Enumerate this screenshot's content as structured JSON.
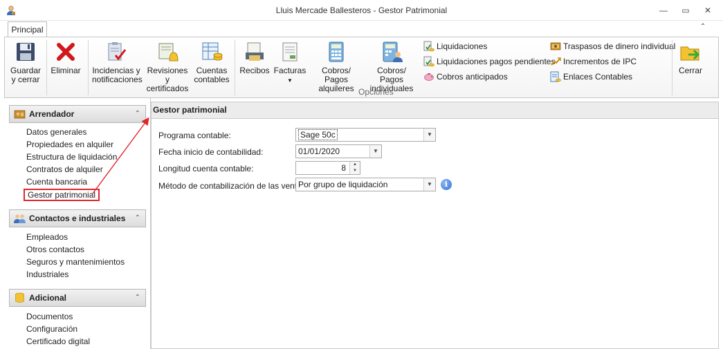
{
  "window": {
    "title": "Lluis Mercade Ballesteros - Gestor Patrimonial",
    "minimize": "—",
    "maximize": "▭",
    "close": "✕"
  },
  "ribbon": {
    "tabs": [
      "Principal"
    ],
    "collapse_glyph": "⌃",
    "buttons": {
      "guardar": "Guardar y cerrar",
      "eliminar": "Eliminar",
      "incidencias": "Incidencias y notificaciones",
      "revisiones": "Revisiones y certificados",
      "cuentas": "Cuentas contables",
      "recibos": "Recibos",
      "facturas": "Facturas",
      "cobros_alquileres": "Cobros/ Pagos alquileres",
      "cobros_individuales": "Cobros/ Pagos individuales",
      "cerrar": "Cerrar"
    },
    "group_label": "Opciones",
    "small_items": {
      "liquidaciones": "Liquidaciones",
      "liquidaciones_pendientes": "Liquidaciones pagos pendientes",
      "cobros_anticipados": "Cobros anticipados",
      "traspasos": "Traspasos de dinero individual",
      "incrementos_ipc": "Incrementos de IPC",
      "enlaces_contables": "Enlaces Contables"
    },
    "icons": {
      "guardar": "floppy-disk-icon",
      "eliminar": "red-x-icon",
      "incidencias": "clipboard-check-icon",
      "revisiones": "certificate-bell-icon",
      "cuentas": "ledger-coins-icon",
      "recibos": "receipt-printer-icon",
      "facturas": "invoice-icon",
      "cobros_alquileres": "calculator-icon",
      "cobros_individuales": "calculator-user-icon",
      "cerrar": "folder-exit-icon"
    }
  },
  "sidebar": {
    "sections": [
      {
        "title": "Arrendador",
        "items": [
          "Datos generales",
          "Propiedades en alquiler",
          "Estructura de liquidación",
          "Contratos de alquiler",
          "Cuenta bancaria",
          "Gestor patrimonial"
        ]
      },
      {
        "title": "Contactos e industriales",
        "items": [
          "Empleados",
          "Otros contactos",
          "Seguros y mantenimientos",
          "Industriales"
        ]
      },
      {
        "title": "Adicional",
        "items": [
          "Documentos",
          "Configuración",
          "Certificado digital"
        ]
      }
    ],
    "active_item": "Gestor patrimonial",
    "chevron": "⌃"
  },
  "content": {
    "header": "Gestor patrimonial",
    "fields": {
      "programa_label": "Programa contable:",
      "programa_value": "Sage 50c",
      "fecha_label": "Fecha inicio de contabilidad:",
      "fecha_value": "01/01/2020",
      "longitud_label": "Longitud cuenta contable:",
      "longitud_value": "8",
      "metodo_label": "Método de contabilización de las ventas:",
      "metodo_value": "Por grupo de liquidación"
    },
    "info_glyph": "i"
  },
  "colors": {
    "highlight_red": "#e0252b",
    "accent_blue": "#2f6fd1"
  }
}
